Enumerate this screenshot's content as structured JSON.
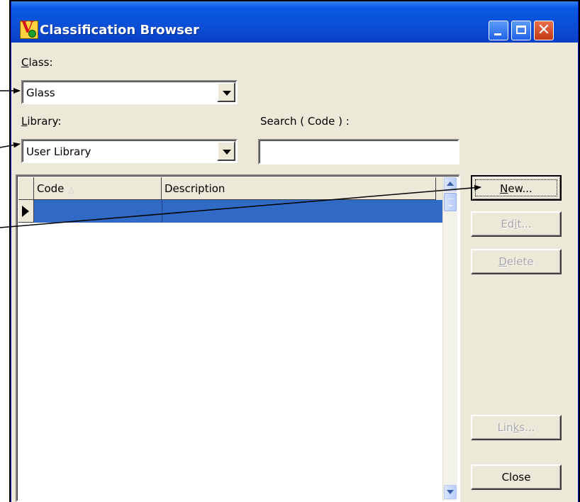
{
  "window": {
    "title": "Classification Browser",
    "titlebar_color": "#0a4fd6",
    "close_glyph": "✕"
  },
  "form": {
    "class_label": "Class:",
    "class_label_underline": "C",
    "class_label_rest": "lass:",
    "class_value": "Glass",
    "library_label": "Library:",
    "library_label_underline": "L",
    "library_label_rest": "ibrary:",
    "library_value": "User Library",
    "search_label": "Search ( Code ) :",
    "search_value": ""
  },
  "grid": {
    "columns": [
      {
        "label": "Code",
        "sort_icon": "△"
      },
      {
        "label": "Description"
      }
    ],
    "rows": [
      {
        "code": "",
        "description": "",
        "selected": true
      }
    ],
    "selection_color": "#316ac5"
  },
  "buttons": {
    "new": {
      "label": "New...",
      "underline": "N",
      "rest": "ew...",
      "enabled": true
    },
    "edit": {
      "label": "Edit...",
      "pre": "Ed",
      "underline": "i",
      "rest": "t...",
      "enabled": false
    },
    "delete": {
      "label": "Delete",
      "underline": "D",
      "rest": "elete",
      "enabled": false
    },
    "links": {
      "label": "Links...",
      "pre": "Lin",
      "underline": "k",
      "rest": "s...",
      "enabled": false
    },
    "close": {
      "label": "Close",
      "enabled": true
    }
  }
}
